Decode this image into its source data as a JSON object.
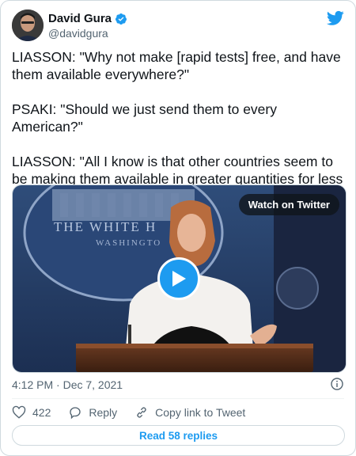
{
  "author": {
    "name": "David Gura",
    "handle": "@davidgura"
  },
  "tweet": {
    "text": "LIASSON: \"Why not make [rapid tests] free, and have them available everywhere?\"\n\nPSAKI: \"Should we just send them to every American?\"\n\nLIASSON: \"All I know is that other countries seem to be making them available in greater quantities for less money.\"",
    "timestamp": "4:12 PM · Dec 7, 2021"
  },
  "media": {
    "watch_label": "Watch on Twitter",
    "sign_line1": "THE WHITE H",
    "sign_line2": "WASHINGTO"
  },
  "actions": {
    "likes": "422",
    "reply_label": "Reply",
    "copy_label": "Copy link to Tweet"
  },
  "footer": {
    "read_replies": "Read 58 replies"
  },
  "colors": {
    "accent": "#1d9bf0",
    "secondary_text": "#536471",
    "border": "#cfd9de"
  }
}
